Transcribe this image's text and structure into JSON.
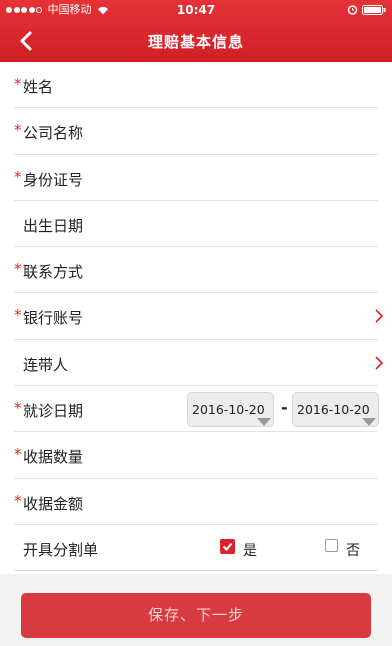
{
  "status_bar": {
    "carrier": "中国移动",
    "time": "10:47",
    "signal_icon": "signal-dots-icon",
    "wifi_icon": "wifi-icon",
    "alarm_icon": "alarm-clock-icon",
    "battery_icon": "battery-icon"
  },
  "nav": {
    "title": "理赔基本信息",
    "back_icon": "chevron-left-icon"
  },
  "form": {
    "required_mark": "*",
    "fields": [
      {
        "label": "姓名",
        "required": true
      },
      {
        "label": "公司名称",
        "required": true
      },
      {
        "label": "身份证号",
        "required": true
      },
      {
        "label": "出生日期",
        "required": false
      },
      {
        "label": "联系方式",
        "required": true
      },
      {
        "label": "银行账号",
        "required": true,
        "chevron": true
      },
      {
        "label": "连带人",
        "required": false,
        "chevron": true
      },
      {
        "label": "就诊日期",
        "required": true
      },
      {
        "label": "收据数量",
        "required": true
      },
      {
        "label": "收据金额",
        "required": true
      },
      {
        "label": "开具分割单",
        "required": false
      }
    ],
    "date_start": "2016-10-20",
    "date_separator": "-",
    "date_end": "2016-10-20",
    "split_yes": "是",
    "split_no": "否",
    "split_yes_checked": true,
    "split_no_checked": false
  },
  "footer": {
    "submit_label": "保存、下一步"
  },
  "colors": {
    "brand_red": "#d9242b",
    "required_star": "#e32a2a",
    "button_bg": "#d73a3f"
  }
}
